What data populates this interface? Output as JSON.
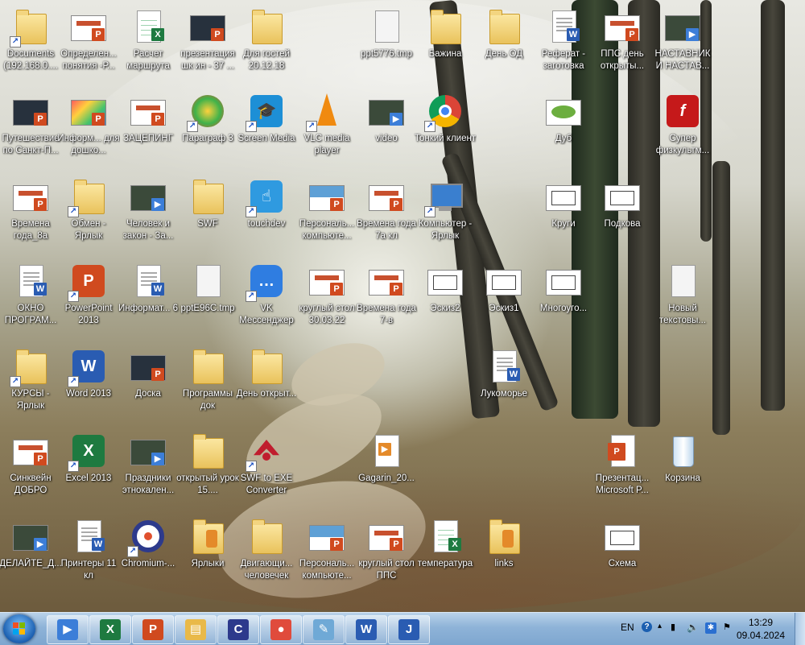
{
  "desktop": {
    "icons": [
      {
        "label": "Documents (192.168.0....",
        "kind": "folder",
        "shortcut": true
      },
      {
        "label": "Определен... понятия -Р...",
        "kind": "ppt"
      },
      {
        "label": "Расчет маршрута",
        "kind": "xls"
      },
      {
        "label": "презентация шк ин - 37 ...",
        "kind": "ppt-dark"
      },
      {
        "label": "Для гостей 20.12.18",
        "kind": "folder"
      },
      {
        "label": "ppt5776.tmp",
        "kind": "blank"
      },
      {
        "label": "Бажина",
        "kind": "folder"
      },
      {
        "label": "День ОД",
        "kind": "folder"
      },
      {
        "label": "Реферат - заготовка",
        "kind": "word"
      },
      {
        "label": "ППС день открыты...",
        "kind": "ppt"
      },
      {
        "label": "НАСТАВНИК И НАСТАВ...",
        "kind": "video"
      },
      {
        "label": "Путешествие по Санкт-П...",
        "kind": "ppt-dark"
      },
      {
        "label": "Информ... для дошко...",
        "kind": "ppt-colorful"
      },
      {
        "label": "ЗАЦЕПИНГ",
        "kind": "ppt"
      },
      {
        "label": "Параграф 3",
        "kind": "app-green",
        "shortcut": true
      },
      {
        "label": "Screen Media",
        "kind": "app-blue",
        "shortcut": true
      },
      {
        "label": "VLC media player",
        "kind": "vlc",
        "shortcut": true
      },
      {
        "label": "video",
        "kind": "video"
      },
      {
        "label": "Тонкий клиент",
        "kind": "chrome",
        "shortcut": true
      },
      {
        "label": "Дуб",
        "kind": "image-green"
      },
      {
        "label": "Супер физкультм...",
        "kind": "flash"
      },
      {
        "label": "Времена года_8а",
        "kind": "ppt"
      },
      {
        "label": "Обмен - Ярлык",
        "kind": "folder",
        "shortcut": true
      },
      {
        "label": "Человек и закон - За...",
        "kind": "video"
      },
      {
        "label": "SWF",
        "kind": "folder"
      },
      {
        "label": "touchdev",
        "kind": "app-touch",
        "shortcut": true
      },
      {
        "label": "Персональ... компьюте...",
        "kind": "ppt-blue"
      },
      {
        "label": "Времена года 7а кл",
        "kind": "ppt"
      },
      {
        "label": "Компьютер - Ярлык",
        "kind": "computer",
        "shortcut": true
      },
      {
        "label": "Круги",
        "kind": "image"
      },
      {
        "label": "Подкова",
        "kind": "image"
      },
      {
        "label": "ОКНО ПРОГРАМ...",
        "kind": "word"
      },
      {
        "label": "PowerPoint 2013",
        "kind": "ppt-app",
        "shortcut": true
      },
      {
        "label": "Информат... 6",
        "kind": "word"
      },
      {
        "label": "pptE96C.tmp",
        "kind": "blank"
      },
      {
        "label": "VK Мессенджер",
        "kind": "vk",
        "shortcut": true
      },
      {
        "label": "круглый стол 30.03.22",
        "kind": "ppt"
      },
      {
        "label": "Времена года 7-в",
        "kind": "ppt"
      },
      {
        "label": "Эскиз2",
        "kind": "image"
      },
      {
        "label": "Эскиз1",
        "kind": "image"
      },
      {
        "label": "Многоуго...",
        "kind": "image"
      },
      {
        "label": "Новый текстовы...",
        "kind": "blank"
      },
      {
        "label": "КУРСЫ - Ярлык",
        "kind": "folder",
        "shortcut": true
      },
      {
        "label": "Word 2013",
        "kind": "word-app",
        "shortcut": true
      },
      {
        "label": "Доска",
        "kind": "ppt-dark"
      },
      {
        "label": "Программы док",
        "kind": "folder"
      },
      {
        "label": "День открыт...",
        "kind": "folder"
      },
      {
        "label": "Лукоморье",
        "kind": "word"
      },
      {
        "label": "Синквейн ДОБРО",
        "kind": "ppt"
      },
      {
        "label": "Excel 2013",
        "kind": "xls-app",
        "shortcut": true
      },
      {
        "label": "Праздники этнокален...",
        "kind": "video"
      },
      {
        "label": "открытый урок 15....",
        "kind": "folder"
      },
      {
        "label": "SWF to EXE Converter",
        "kind": "swf2exe",
        "shortcut": true
      },
      {
        "label": "Gagarin_20...",
        "kind": "video-file"
      },
      {
        "label": "Презентац... Microsoft P...",
        "kind": "ppt-doc"
      },
      {
        "label": "Корзина",
        "kind": "recycle"
      },
      {
        "label": "ДЕЛАЙТЕ_Д...",
        "kind": "video"
      },
      {
        "label": "Принтеры 11 кл",
        "kind": "word"
      },
      {
        "label": "Chromium-...",
        "kind": "chromium",
        "shortcut": true
      },
      {
        "label": "Ярлыки",
        "kind": "folder-music"
      },
      {
        "label": "Двигающи... человечек",
        "kind": "folder"
      },
      {
        "label": "Персональ... компьюте...",
        "kind": "ppt-blue"
      },
      {
        "label": "круглый стол ППС",
        "kind": "ppt"
      },
      {
        "label": "температура",
        "kind": "xls"
      },
      {
        "label": "links",
        "kind": "folder-music"
      },
      {
        "label": "Схема",
        "kind": "image"
      }
    ]
  },
  "taskbar": {
    "start_label": "Start",
    "pinned": [
      {
        "name": "media",
        "glyph": "▶",
        "color": "#3c7ed8"
      },
      {
        "name": "excel",
        "glyph": "X",
        "color": "#1e7a40"
      },
      {
        "name": "powerpoint",
        "glyph": "P",
        "color": "#d04a1f"
      },
      {
        "name": "explorer",
        "glyph": "▤",
        "color": "#e9b949"
      },
      {
        "name": "chromium",
        "glyph": "C",
        "color": "#2d3a8c"
      },
      {
        "name": "chrome",
        "glyph": "●",
        "color": "#e04b3c"
      },
      {
        "name": "notepad",
        "glyph": "✎",
        "color": "#6fa9d6"
      },
      {
        "name": "word",
        "glyph": "W",
        "color": "#2a5cb2"
      },
      {
        "name": "touchdev",
        "glyph": "J",
        "color": "#2a5cb2"
      }
    ],
    "tray": {
      "language": "EN",
      "help": "?",
      "time": "13:29",
      "date": "09.04.2024"
    }
  }
}
